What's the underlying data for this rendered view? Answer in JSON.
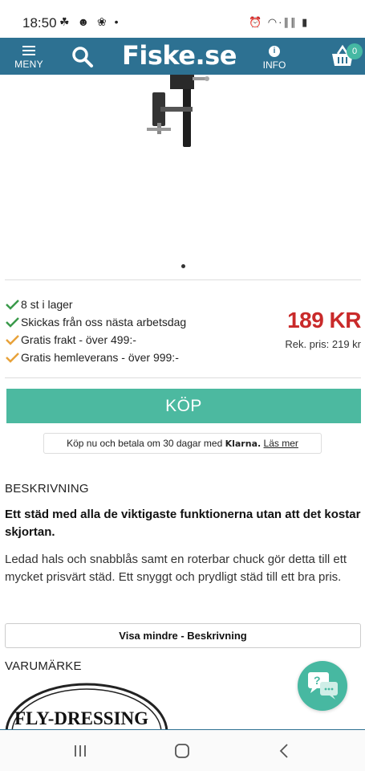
{
  "status_bar": {
    "time": "18:50",
    "left_icons": "☘ ☻ ❀ •",
    "right_icons": "⏰ ◠·∥∥ ▮"
  },
  "header": {
    "menu_label": "MENY",
    "logo_text": "Fiske.se",
    "info_label": "INFO",
    "cart_count": "0"
  },
  "stock": {
    "items": [
      {
        "text": "8 st i lager",
        "icon": "green-check-icon"
      },
      {
        "text": "Skickas från oss nästa arbetsdag",
        "icon": "green-check-icon"
      },
      {
        "text": "Gratis frakt - över 499:-",
        "icon": "orange-check-icon"
      },
      {
        "text": "Gratis hemleverans - över 999:-",
        "icon": "orange-check-icon"
      }
    ]
  },
  "pricing": {
    "price": "189 KR",
    "rek_price": "Rek. pris: 219 kr"
  },
  "buy": {
    "label": "KÖP",
    "klarna_prefix": "Köp nu och betala om 30 dagar med",
    "klarna_brand": "Klarna.",
    "klarna_link": "Läs mer"
  },
  "description": {
    "heading": "BESKRIVNING",
    "lead": "Ett städ med alla de viktigaste funktionerna utan att det kostar skjortan.",
    "body": "Ledad hals och snabblås samt en roterbar chuck gör detta till ett mycket prisvärt städ. Ett snyggt och prydligt städ till ett bra pris.",
    "toggle_label": "Visa mindre - Beskrivning"
  },
  "brand": {
    "heading": "VARUMÄRKE",
    "logo_text": "FLY-DRESSING"
  },
  "chat": {
    "label": "?"
  },
  "colors": {
    "header": "#2d7192",
    "accent": "#4cb9a0",
    "price": "#c92a2a",
    "check_green": "#3a9a4a",
    "check_orange": "#e8a23a"
  }
}
